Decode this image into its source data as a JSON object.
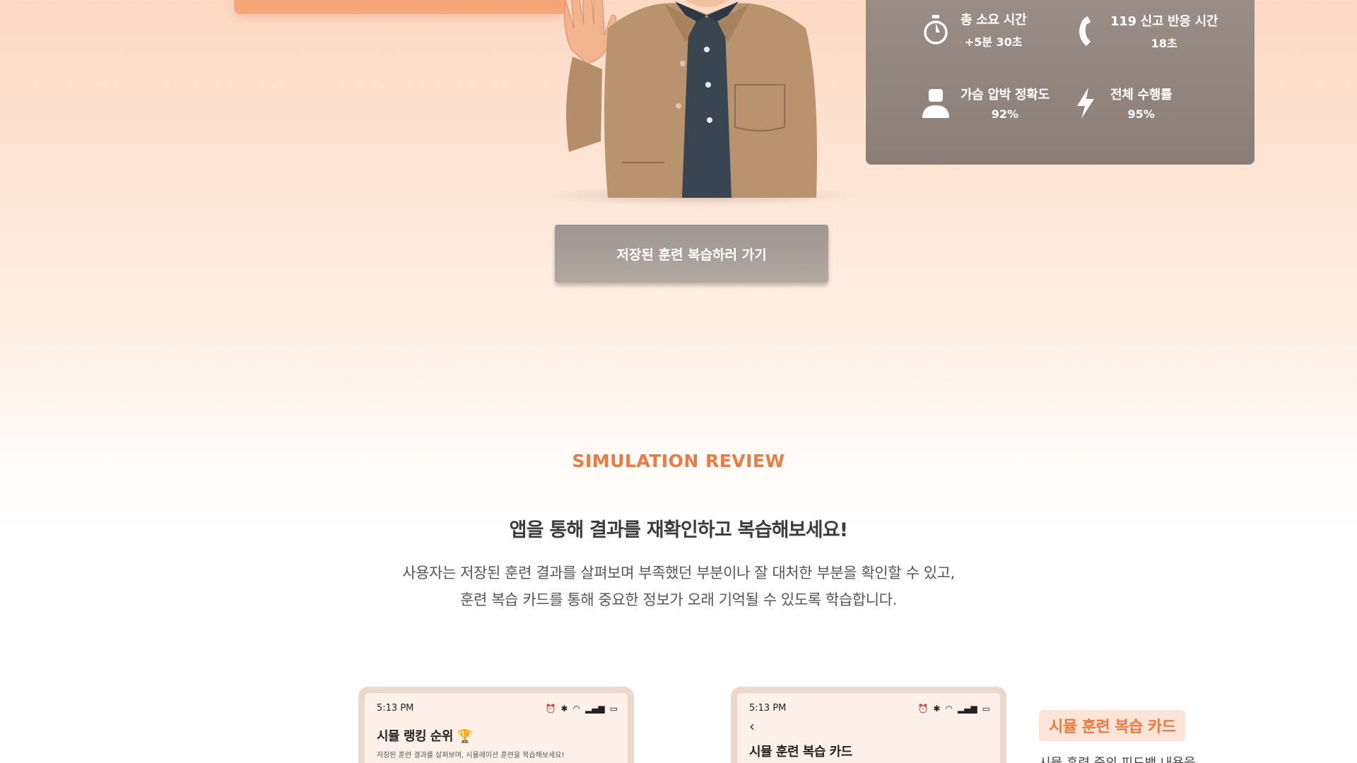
{
  "colors": {
    "accent": "#ec7a45",
    "stats_panel": "#958982",
    "button": "#a9a09b",
    "phone_frame": "#ead8cf"
  },
  "stats": [
    {
      "icon": "stopwatch-icon",
      "label": "총 소요 시간",
      "value": "+5분 30초"
    },
    {
      "icon": "phone-handset-icon",
      "label": "119 신고 반응 시간",
      "value": "18초"
    },
    {
      "icon": "person-icon",
      "label": "가슴 압박 정확도",
      "value": "92%"
    },
    {
      "icon": "lightning-icon",
      "label": "전체 수행률",
      "value": "95%"
    }
  ],
  "review_button": {
    "label": "저장된 훈련 복습하러 가기"
  },
  "section": {
    "eyebrow": "SIMULATION REVIEW",
    "title": "앱을 통해 결과를 재확인하고 복습해보세요!",
    "desc_line1": "사용자는 저장된 훈련 결과를 살펴보며 부족했던 부분이나 잘 대처한 부분을 확인할 수 있고,",
    "desc_line2": "훈련 복습 카드를 통해 중요한 정보가 오래 기억될 수 있도록 학습합니다."
  },
  "phone1": {
    "time": "5:13 PM",
    "title": "시뮬 랭킹 순위 🏆",
    "subtitle": "저장된 훈련 결과를 살펴보며, 시뮬레이션 훈련을 복습해보세요!"
  },
  "phone2": {
    "time": "5:13 PM",
    "back": "‹",
    "title": "시뮬 훈련 복습 카드"
  },
  "side": {
    "label": "시뮬 훈련 복습 카드",
    "text": "시뮬 훈련 중의 피드백 내용을"
  }
}
